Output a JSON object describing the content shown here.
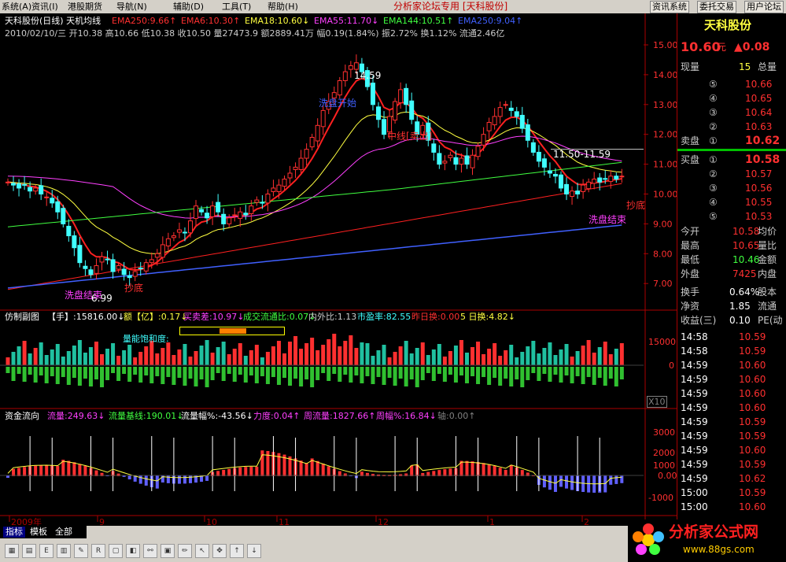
{
  "menu": {
    "items": [
      "系统(A)",
      "资讯(I)",
      "港股期货",
      "导航(N)",
      "辅助(D)",
      "工具(T)",
      "帮助(H)"
    ],
    "center_title": "分析家论坛专用 [天科股份]",
    "right_buttons": [
      "资讯系统",
      "委托交易",
      "用户论坛"
    ]
  },
  "main_header": {
    "title": "天科股份(日线) 天机均线",
    "ema_labels": [
      {
        "text": "EMA250:9.66↑",
        "color": "#ff3030"
      },
      {
        "text": "EMA6:10.30↑",
        "color": "#ff3030"
      },
      {
        "text": "EMA18:10.60↓",
        "color": "#ffff40"
      },
      {
        "text": "EMA55:11.70↓",
        "color": "#ff40ff"
      },
      {
        "text": "EMA144:10.51↑",
        "color": "#40ff40"
      },
      {
        "text": "EMA250:9.04↑",
        "color": "#4060ff"
      }
    ],
    "info_line": "2010/02/10/三 开10.38 高10.66 低10.38 收10.50 量27473.9 额2889.41万 幅0.19(1.84%) 振2.72% 换1.12% 流通2.46亿"
  },
  "price_axis": [
    "15.00",
    "14.00",
    "13.00",
    "12.00",
    "11.00",
    "10.00",
    "9.00",
    "8.00",
    "7.00"
  ],
  "annotations": {
    "high": "14.59",
    "low": "6.99",
    "range": "11.50-11.59",
    "wash_start_1": "洗盘开始",
    "wash_end_1": "洗盘结束",
    "bottom_buy_1": "抄底",
    "mid_line_1": "中线[卖出]",
    "bottom_buy_2": "抄底",
    "wash_end_2": "洗盘结束"
  },
  "vol_panel": {
    "title": "仿制副图",
    "labels": [
      {
        "text": "【手】:15816.00↓",
        "color": "#ffffff"
      },
      {
        "text": "额【亿】:0.17↓",
        "color": "#ffff40"
      },
      {
        "text": "买卖差:10.97↓",
        "color": "#ff40ff"
      },
      {
        "text": "成交流通比:0.07↓",
        "color": "#40ff40"
      },
      {
        "text": "内外比:1.13",
        "color": "#cccccc"
      },
      {
        "text": "市盈率:82.55",
        "color": "#40ffff"
      },
      {
        "text": "昨日换:0.00",
        "color": "#ff3030"
      },
      {
        "text": "5 日换:4.82↓",
        "color": "#ffff40"
      }
    ],
    "saturation_label": "量能饱和度:",
    "axis": [
      "15000",
      "0"
    ],
    "unit": "X10"
  },
  "flow_panel": {
    "title": "资金流向",
    "labels": [
      {
        "text": "流量:249.63↓",
        "color": "#ff40ff"
      },
      {
        "text": "流量基线:190.01↓",
        "color": "#40ff40"
      },
      {
        "text": "流量幅%:-43.56↓",
        "color": "#ffffff"
      },
      {
        "text": "力度:0.04↑",
        "color": "#ff40ff"
      },
      {
        "text": "周流量:1827.66↑",
        "color": "#ff40ff"
      },
      {
        "text": "周幅%:16.84↓",
        "color": "#ff40ff"
      },
      {
        "text": "轴:0.00↑",
        "color": "#808080"
      }
    ],
    "axis": [
      "3000",
      "2000",
      "1000",
      "0.00",
      "-1000"
    ]
  },
  "time_axis": [
    "2009年",
    "9",
    "10",
    "11",
    "12",
    "1",
    "2"
  ],
  "bottom_tabs": [
    "指标",
    "模板",
    "全部"
  ],
  "quote": {
    "name": "天科股份",
    "price": "10.60",
    "price_unit": "元",
    "change": "▲0.08",
    "now_vol_label": "现量",
    "now_vol": "15",
    "total_vol_label": "总量",
    "asks": [
      {
        "level": "⑤",
        "price": "10.66"
      },
      {
        "level": "④",
        "price": "10.65"
      },
      {
        "level": "③",
        "price": "10.64"
      },
      {
        "level": "②",
        "price": "10.63"
      },
      {
        "level": "①",
        "price": "10.62",
        "label": "卖盘"
      }
    ],
    "bids": [
      {
        "level": "①",
        "price": "10.58",
        "label": "买盘"
      },
      {
        "level": "②",
        "price": "10.57"
      },
      {
        "level": "③",
        "price": "10.56"
      },
      {
        "level": "④",
        "price": "10.55"
      },
      {
        "level": "⑤",
        "price": "10.53"
      }
    ],
    "stats": [
      {
        "l1": "今开",
        "v1": "10.58",
        "l2": "均价"
      },
      {
        "l1": "最高",
        "v1": "10.65",
        "l2": "量比"
      },
      {
        "l1": "最低",
        "v1": "10.46",
        "l2": "金额"
      },
      {
        "l1": "外盘",
        "v1": "7425",
        "l2": "内盘"
      }
    ],
    "stats2": [
      {
        "l1": "换手",
        "v1": "0.64%",
        "l2": "股本"
      },
      {
        "l1": "净资",
        "v1": "1.85",
        "l2": "流通"
      },
      {
        "l1": "收益(三)",
        "v1": "0.10",
        "l2": "PE(动"
      }
    ],
    "ticks": [
      {
        "time": "14:58",
        "price": "10.59"
      },
      {
        "time": "14:58",
        "price": "10.59"
      },
      {
        "time": "14:59",
        "price": "10.60"
      },
      {
        "time": "14:59",
        "price": "10.60"
      },
      {
        "time": "14:59",
        "price": "10.60"
      },
      {
        "time": "14:59",
        "price": "10.60"
      },
      {
        "time": "14:59",
        "price": "10.59"
      },
      {
        "time": "14:59",
        "price": "10.59"
      },
      {
        "time": "14:59",
        "price": "10.60"
      },
      {
        "time": "14:59",
        "price": "10.59"
      },
      {
        "time": "14:59",
        "price": "10.62"
      },
      {
        "time": "15:00",
        "price": "10.59"
      },
      {
        "time": "15:00",
        "price": "10.60"
      }
    ]
  },
  "logo": {
    "title": "分析家公式网",
    "url": "www.88gs.com"
  },
  "colors": {
    "up": "#ff3030",
    "down": "#40ffff",
    "grid": "#800000",
    "bg": "#000000"
  }
}
